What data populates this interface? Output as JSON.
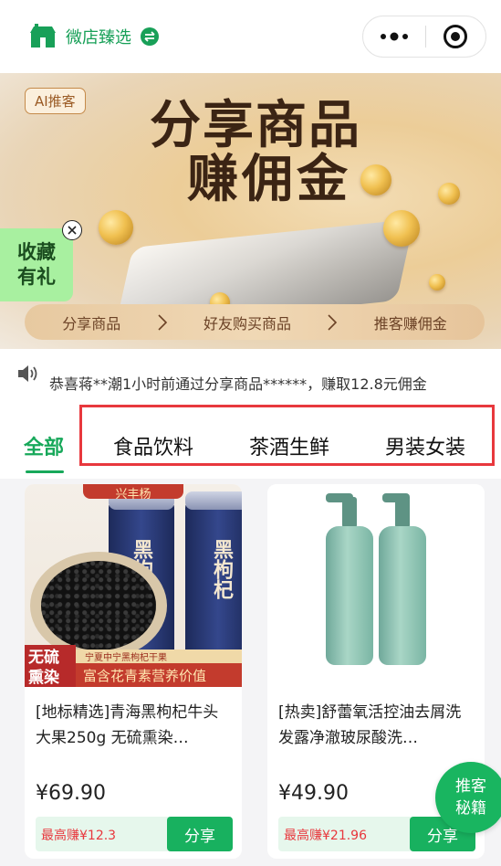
{
  "header": {
    "brand_name": "微店臻选",
    "brand_icon": "shop-logo-icon",
    "switch_icon": "switch-arrows-icon",
    "capsule": {
      "more_icon": "more-dots-icon",
      "close_icon": "target-circle-icon"
    }
  },
  "banner": {
    "ai_tag": "AI推客",
    "headline_line1": "分享商品",
    "headline_line2": "赚佣金",
    "favorite_badge": {
      "line1": "收藏",
      "line2": "有礼"
    },
    "steps": [
      "分享商品",
      "好友购买商品",
      "推客赚佣金"
    ]
  },
  "notice": {
    "icon": "speaker-icon",
    "text": "恭喜蒋**潮1小时前通过分享商品******，赚取12.8元佣金"
  },
  "tabs": {
    "active": "全部",
    "items": [
      "食品饮料",
      "茶酒生鲜",
      "男装女装"
    ]
  },
  "products": [
    {
      "title": "[地标精选]青海黑枸杞牛头大果250g 无硫熏染…",
      "price": "¥69.90",
      "earn": "最高赚¥12.3",
      "share": "分享",
      "image_texts": {
        "top_tag": "兴丰杨",
        "jar_label_1": "黑枸杞",
        "jar_label_2": "黑枸杞",
        "badge": "无硫熏染",
        "strip_top": "宁夏中宁黑枸杞干果",
        "strip": "富含花青素营养价值"
      }
    },
    {
      "title": "[热卖]舒蕾氧活控油去屑洗发露净澈玻尿酸洗…",
      "price": "¥49.90",
      "earn": "最高赚¥21.96",
      "share": "分享"
    }
  ],
  "fab": {
    "line1": "推客",
    "line2": "秘籍"
  },
  "colors": {
    "brand_green": "#18a058",
    "accent_red": "#e8383d",
    "share_green": "#18b15f"
  }
}
